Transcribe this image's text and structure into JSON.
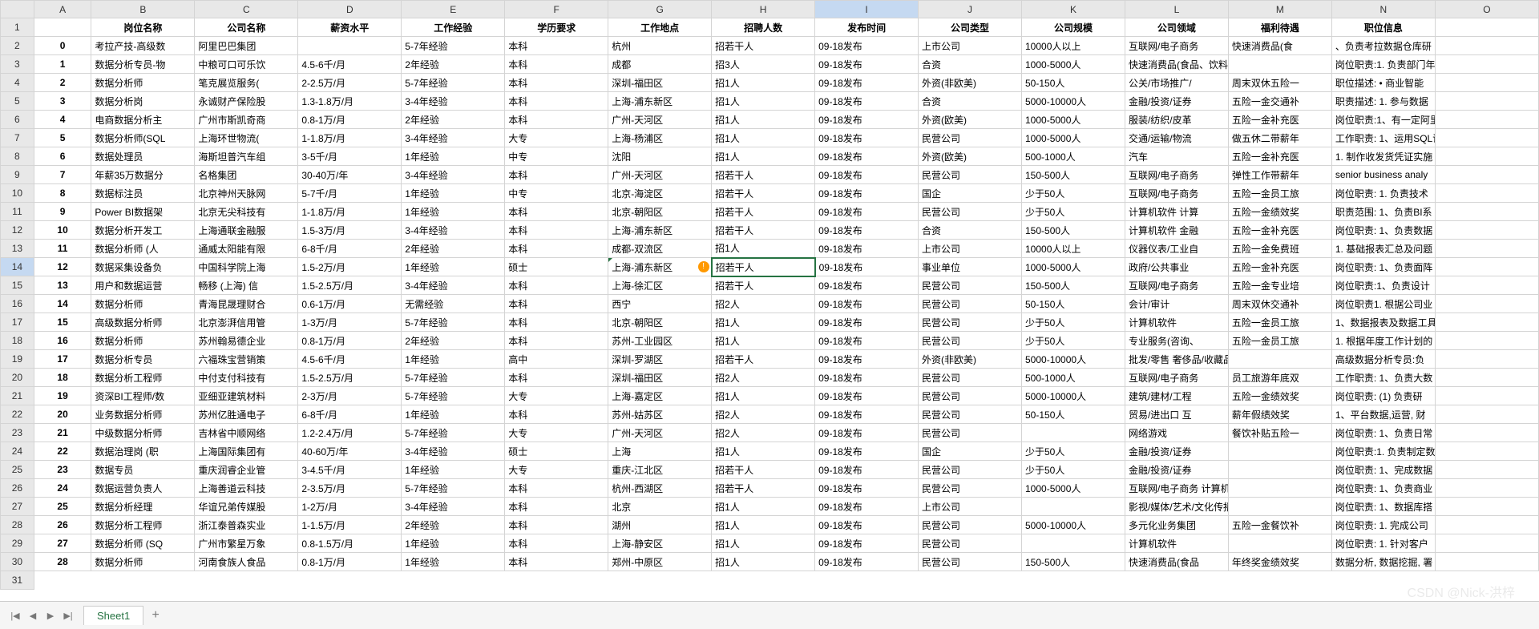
{
  "columns": [
    "A",
    "B",
    "C",
    "D",
    "E",
    "F",
    "G",
    "H",
    "I",
    "J",
    "K",
    "L",
    "M",
    "N",
    "O"
  ],
  "headers": [
    "",
    "岗位名称",
    "公司名称",
    "薪资水平",
    "工作经验",
    "学历要求",
    "工作地点",
    "招聘人数",
    "发布时间",
    "公司类型",
    "公司规模",
    "公司领域",
    "福利待遇",
    "职位信息",
    ""
  ],
  "selected_cell": {
    "row": 14,
    "col": 9
  },
  "indicator_cell": {
    "row": 14,
    "col": 8
  },
  "sheet_tab": "Sheet1",
  "watermark": "CSDN @Nick-洪梓",
  "rows": [
    {
      "A": "0",
      "B": "考拉产技-高级数",
      "C": "阿里巴巴集团",
      "D": "",
      "E": "5-7年经验",
      "F": "本科",
      "G": "杭州",
      "H": "招若干人",
      "I": "09-18发布",
      "J": "上市公司",
      "K": "10000人以上",
      "L": "互联网/电子商务",
      "M": "快速消费品(食",
      "N": "、负责考拉数据仓库研"
    },
    {
      "A": "1",
      "B": "数据分析专员-物",
      "C": "中粮可口可乐饮",
      "D": "4.5-6千/月",
      "E": "2年经验",
      "F": "本科",
      "G": "成都",
      "H": "招3人",
      "I": "09-18发布",
      "J": "合资",
      "K": "1000-5000人",
      "L": "快速消费品(食品、饮料、化妆品",
      "M": "",
      "N": "岗位职责:1. 负责部门年"
    },
    {
      "A": "2",
      "B": "数据分析师",
      "C": "笔克展览服务(",
      "D": "2-2.5万/月",
      "E": "5-7年经验",
      "F": "本科",
      "G": "深圳-福田区",
      "H": "招1人",
      "I": "09-18发布",
      "J": "外资(非欧美)",
      "K": "50-150人",
      "L": "公关/市场推广/",
      "M": "周末双休五险一",
      "N": "职位描述: • 商业智能"
    },
    {
      "A": "3",
      "B": "数据分析岗",
      "C": "永诚财产保险股",
      "D": "1.3-1.8万/月",
      "E": "3-4年经验",
      "F": "本科",
      "G": "上海-浦东新区",
      "H": "招1人",
      "I": "09-18发布",
      "J": "合资",
      "K": "5000-10000人",
      "L": "金融/投资/证券",
      "M": "五险一金交通补",
      "N": "职责描述: 1. 参与数据"
    },
    {
      "A": "4",
      "B": "电商数据分析主",
      "C": "广州市斯凯奇商",
      "D": "0.8-1万/月",
      "E": "2年经验",
      "F": "本科",
      "G": "广州-天河区",
      "H": "招1人",
      "I": "09-18发布",
      "J": "外资(欧美)",
      "K": "1000-5000人",
      "L": "服装/纺织/皮革",
      "M": "五险一金补充医",
      "N": "岗位职责:1、有一定阿里"
    },
    {
      "A": "5",
      "B": "数据分析师(SQL",
      "C": "上海环世物流(",
      "D": "1-1.8万/月",
      "E": "3-4年经验",
      "F": "大专",
      "G": "上海-杨浦区",
      "H": "招1人",
      "I": "09-18发布",
      "J": "民营公司",
      "K": "1000-5000人",
      "L": "交通/运输/物流",
      "M": "做五休二带薪年",
      "N": "工作职责: 1、运用SQL语"
    },
    {
      "A": "6",
      "B": "数据处理员",
      "C": "海斯坦普汽车组",
      "D": "3-5千/月",
      "E": "1年经验",
      "F": "中专",
      "G": "沈阳",
      "H": "招1人",
      "I": "09-18发布",
      "J": "外资(欧美)",
      "K": "500-1000人",
      "L": "汽车",
      "M": "五险一金补充医",
      "N": "1. 制作收发货凭证实施"
    },
    {
      "A": "7",
      "B": "年薪35万数据分",
      "C": "名格集团",
      "D": "30-40万/年",
      "E": "3-4年经验",
      "F": "本科",
      "G": "广州-天河区",
      "H": "招若干人",
      "I": "09-18发布",
      "J": "民营公司",
      "K": "150-500人",
      "L": "互联网/电子商务",
      "M": "弹性工作带薪年",
      "N": "senior business analy"
    },
    {
      "A": "8",
      "B": "数据标注员",
      "C": "北京神州天脉网",
      "D": "5-7千/月",
      "E": "1年经验",
      "F": "中专",
      "G": "北京-海淀区",
      "H": "招若干人",
      "I": "09-18发布",
      "J": "国企",
      "K": "少于50人",
      "L": "互联网/电子商务",
      "M": "五险一金员工旅",
      "N": "岗位职责: 1. 负责技术"
    },
    {
      "A": "9",
      "B": "Power BI数据架",
      "C": "北京无尖科技有",
      "D": "1-1.8万/月",
      "E": "1年经验",
      "F": "本科",
      "G": "北京-朝阳区",
      "H": "招若干人",
      "I": "09-18发布",
      "J": "民营公司",
      "K": "少于50人",
      "L": "计算机软件 计算",
      "M": "五险一金绩效奖",
      "N": "职责范围: 1、负责BI系"
    },
    {
      "A": "10",
      "B": "数据分析开发工",
      "C": "上海通联金融服",
      "D": "1.5-3万/月",
      "E": "3-4年经验",
      "F": "本科",
      "G": "上海-浦东新区",
      "H": "招若干人",
      "I": "09-18发布",
      "J": "合资",
      "K": "150-500人",
      "L": "计算机软件 金融",
      "M": "五险一金补充医",
      "N": "岗位职责: 1、负责数据"
    },
    {
      "A": "11",
      "B": "数据分析师 (人",
      "C": "通威太阳能有限",
      "D": "6-8千/月",
      "E": "2年经验",
      "F": "本科",
      "G": "成都-双流区",
      "H": "招1人",
      "I": "09-18发布",
      "J": "上市公司",
      "K": "10000人以上",
      "L": "仪器仪表/工业自",
      "M": "五险一金免费班",
      "N": "1. 基础报表汇总及问题"
    },
    {
      "A": "12",
      "B": "数据采集设备负",
      "C": "中国科学院上海",
      "D": "1.5-2万/月",
      "E": "1年经验",
      "F": "硕士",
      "G": "上海-浦东新区",
      "H": "招若干人",
      "I": "09-18发布",
      "J": "事业单位",
      "K": "1000-5000人",
      "L": "政府/公共事业",
      "M": "五险一金补充医",
      "N": "岗位职责: 1、负责面阵"
    },
    {
      "A": "13",
      "B": "用户和数据运营",
      "C": "畅移 (上海) 信",
      "D": "1.5-2.5万/月",
      "E": "3-4年经验",
      "F": "本科",
      "G": "上海-徐汇区",
      "H": "招若干人",
      "I": "09-18发布",
      "J": "民营公司",
      "K": "150-500人",
      "L": "互联网/电子商务",
      "M": "五险一金专业培",
      "N": "岗位职责:1、负责设计"
    },
    {
      "A": "14",
      "B": "数据分析师",
      "C": "青海昆晟理财合",
      "D": "0.6-1万/月",
      "E": "无需经验",
      "F": "本科",
      "G": "西宁",
      "H": "招2人",
      "I": "09-18发布",
      "J": "民营公司",
      "K": "50-150人",
      "L": "会计/审计",
      "M": "周末双休交通补",
      "N": "岗位职责1. 根据公司业"
    },
    {
      "A": "15",
      "B": "高级数据分析师",
      "C": "北京澎湃信用管",
      "D": "1-3万/月",
      "E": "5-7年经验",
      "F": "本科",
      "G": "北京-朝阳区",
      "H": "招1人",
      "I": "09-18发布",
      "J": "民营公司",
      "K": "少于50人",
      "L": "计算机软件",
      "M": "五险一金员工旅",
      "N": "1、数据报表及数据工具"
    },
    {
      "A": "16",
      "B": "数据分析师",
      "C": "苏州翰易德企业",
      "D": "0.8-1万/月",
      "E": "2年经验",
      "F": "本科",
      "G": "苏州-工业园区",
      "H": "招1人",
      "I": "09-18发布",
      "J": "民营公司",
      "K": "少于50人",
      "L": "专业服务(咨询、",
      "M": "五险一金员工旅",
      "N": "1. 根据年度工作计划的"
    },
    {
      "A": "17",
      "B": "数据分析专员",
      "C": "六福珠宝营销策",
      "D": "4.5-6千/月",
      "E": "1年经验",
      "F": "高中",
      "G": "深圳-罗湖区",
      "H": "招若干人",
      "I": "09-18发布",
      "J": "外资(非欧美)",
      "K": "5000-10000人",
      "L": "批发/零售 奢侈品/收藏品/工艺品",
      "M": "",
      "N": "高级数据分析专员:负"
    },
    {
      "A": "18",
      "B": "数据分析工程师",
      "C": "中付支付科技有",
      "D": "1.5-2.5万/月",
      "E": "5-7年经验",
      "F": "本科",
      "G": "深圳-福田区",
      "H": "招2人",
      "I": "09-18发布",
      "J": "民营公司",
      "K": "500-1000人",
      "L": "互联网/电子商务",
      "M": "员工旅游年底双",
      "N": "工作职责: 1、负责大数"
    },
    {
      "A": "19",
      "B": "资深BI工程师/数",
      "C": "亚细亚建筑材料",
      "D": "2-3万/月",
      "E": "5-7年经验",
      "F": "大专",
      "G": "上海-嘉定区",
      "H": "招1人",
      "I": "09-18发布",
      "J": "民营公司",
      "K": "5000-10000人",
      "L": "建筑/建材/工程",
      "M": "五险一金绩效奖",
      "N": "岗位职责: (1) 负责研"
    },
    {
      "A": "20",
      "B": "业务数据分析师",
      "C": "苏州亿胜通电子",
      "D": "6-8千/月",
      "E": "1年经验",
      "F": "本科",
      "G": "苏州-姑苏区",
      "H": "招2人",
      "I": "09-18发布",
      "J": "民营公司",
      "K": "50-150人",
      "L": "贸易/进出口 互",
      "M": "薪年假绩效奖",
      "N": "1、平台数据,运营, 财"
    },
    {
      "A": "21",
      "B": "中级数据分析师",
      "C": "吉林省中顺网络",
      "D": "1.2-2.4万/月",
      "E": "5-7年经验",
      "F": "大专",
      "G": "广州-天河区",
      "H": "招2人",
      "I": "09-18发布",
      "J": "民营公司",
      "K": "",
      "L": "网络游戏",
      "M": "餐饮补贴五险一",
      "N": "岗位职责: 1、负责日常"
    },
    {
      "A": "22",
      "B": "数据治理岗 (职",
      "C": "上海国际集团有",
      "D": "40-60万/年",
      "E": "3-4年经验",
      "F": "硕士",
      "G": "上海",
      "H": "招1人",
      "I": "09-18发布",
      "J": "国企",
      "K": "少于50人",
      "L": "金融/投资/证券",
      "M": "",
      "N": "岗位职责:1. 负责制定数"
    },
    {
      "A": "23",
      "B": "数据专员",
      "C": "重庆润睿企业管",
      "D": "3-4.5千/月",
      "E": "1年经验",
      "F": "大专",
      "G": "重庆-江北区",
      "H": "招若干人",
      "I": "09-18发布",
      "J": "民营公司",
      "K": "少于50人",
      "L": "金融/投资/证券",
      "M": "",
      "N": "岗位职责: 1、完成数据"
    },
    {
      "A": "24",
      "B": "数据运营负责人",
      "C": "上海善道云科技",
      "D": "2-3.5万/月",
      "E": "5-7年经验",
      "F": "本科",
      "G": "杭州-西湖区",
      "H": "招若干人",
      "I": "09-18发布",
      "J": "民营公司",
      "K": "1000-5000人",
      "L": "互联网/电子商务 计算机软件",
      "M": "",
      "N": "岗位职责: 1、负责商业"
    },
    {
      "A": "25",
      "B": "数据分析经理",
      "C": "华谊兄弟传媒股",
      "D": "1-2万/月",
      "E": "3-4年经验",
      "F": "本科",
      "G": "北京",
      "H": "招1人",
      "I": "09-18发布",
      "J": "上市公司",
      "K": "",
      "L": "影视/媒体/艺术/文化传播",
      "M": "",
      "N": "岗位职责: 1、数据库搭"
    },
    {
      "A": "26",
      "B": "数据分析工程师",
      "C": "浙江泰普森实业",
      "D": "1-1.5万/月",
      "E": "2年经验",
      "F": "本科",
      "G": "湖州",
      "H": "招1人",
      "I": "09-18发布",
      "J": "民营公司",
      "K": "5000-10000人",
      "L": "多元化业务集团",
      "M": "五险一金餐饮补",
      "N": "岗位职责: 1. 完成公司"
    },
    {
      "A": "27",
      "B": "数据分析师 (SQ",
      "C": "广州市繁星万象",
      "D": "0.8-1.5万/月",
      "E": "1年经验",
      "F": "本科",
      "G": "上海-静安区",
      "H": "招1人",
      "I": "09-18发布",
      "J": "民营公司",
      "K": "",
      "L": "计算机软件",
      "M": "",
      "N": "岗位职责: 1. 针对客户"
    },
    {
      "A": "28",
      "B": "数据分析师",
      "C": "河南食族人食品",
      "D": "0.8-1万/月",
      "E": "1年经验",
      "F": "本科",
      "G": "郑州-中原区",
      "H": "招1人",
      "I": "09-18发布",
      "J": "民营公司",
      "K": "150-500人",
      "L": "快速消费品(食品",
      "M": "年终奖金绩效奖",
      "N": "数据分析, 数据挖掘, 署"
    }
  ]
}
